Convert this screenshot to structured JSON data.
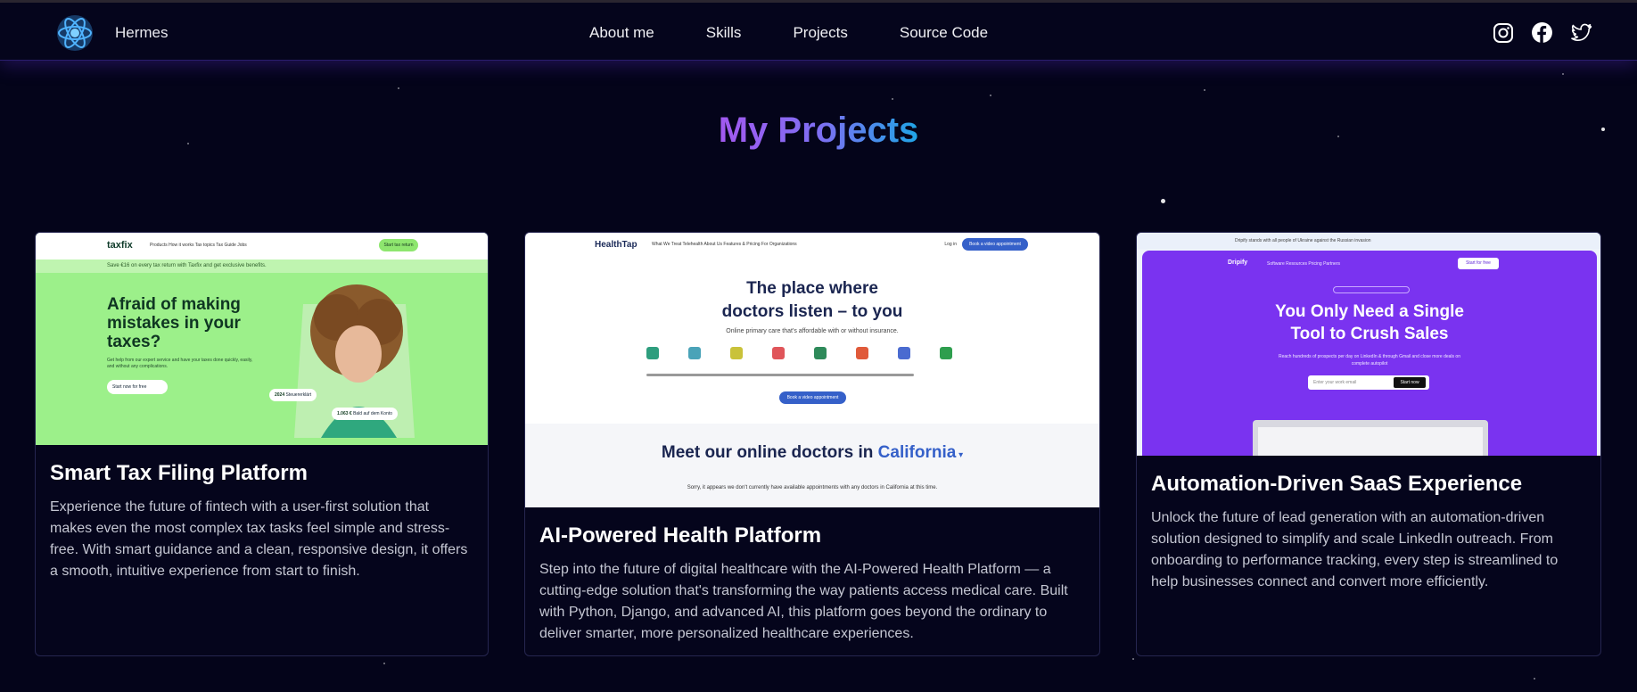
{
  "nav": {
    "brand": "Hermes",
    "menu": [
      "About me",
      "Skills",
      "Projects",
      "Source Code"
    ],
    "social": [
      "instagram-icon",
      "facebook-icon",
      "twitter-icon"
    ]
  },
  "page_title": "My Projects",
  "colors": {
    "background": "#04041a",
    "title_gradient_start": "#a259f0",
    "title_gradient_end": "#1fa5e6",
    "card_border": "#262650"
  },
  "projects": [
    {
      "title": "Smart Tax Filing Platform",
      "description": "Experience the future of fintech with a user-first solution that makes even the most complex tax tasks feel simple and stress-free. With smart guidance and a clean, responsive design, it offers a smooth, intuitive experience from start to finish.",
      "preview": {
        "logo": "taxfix",
        "links": "Products   How it works   Tax topics   Tax Guide   Jobs",
        "cta": "Start tax return",
        "strip": "Save €16 on every tax return with Taxfix and get exclusive benefits.",
        "headline": "Afraid of making mistakes in your taxes?",
        "sub": "Get help from our expert service and have your taxes done quickly, easily, and without any complications.",
        "start": "Start now for free",
        "badge_year": "2024",
        "badge_year_label": "Steuererklärt",
        "badge_amount": "1.063 €",
        "badge_amount_label": "Bald auf dem Konto"
      }
    },
    {
      "title": "AI-Powered Health Platform",
      "description": "Step into the future of digital healthcare with the AI-Powered Health Platform — a cutting-edge solution that's transforming the way patients access medical care. Built with Python, Django, and advanced AI, this platform goes beyond the ordinary to deliver smarter, more personalized healthcare experiences.",
      "preview": {
        "logo": "HealthTap",
        "links": "What We Treat   Telehealth   About Us   Features & Pricing   For Organizations",
        "login": "Log in",
        "book": "Book a video appointment",
        "headline_1": "The place where",
        "headline_2": "doctors listen – to you",
        "sub": "Online primary care that's affordable with or without insurance.",
        "meet": "Meet our online doctors in",
        "state": "California",
        "sorry": "Sorry, it appears we don't currently have available appointments with any doctors in California at this time."
      }
    },
    {
      "title": "Automation-Driven SaaS Experience",
      "description": "Unlock the future of lead generation with an automation-driven solution designed to simplify and scale LinkedIn outreach. From onboarding to performance tracking, every step is streamlined to help businesses connect and convert more efficiently.",
      "preview": {
        "topbar": "Dripify stands with all people of Ukraine against the Russian invasion",
        "logo": "Dripify",
        "links": "Software   Resources   Pricing   Partners",
        "start": "Start for free",
        "headline_1": "You Only Need a Single",
        "headline_2": "Tool to Crush Sales",
        "sub": "Reach hundreds of prospects per day on LinkedIn & through Gmail and close more deals on complete autopilot",
        "email": "Enter your work email",
        "email_btn": "Start now"
      }
    }
  ]
}
